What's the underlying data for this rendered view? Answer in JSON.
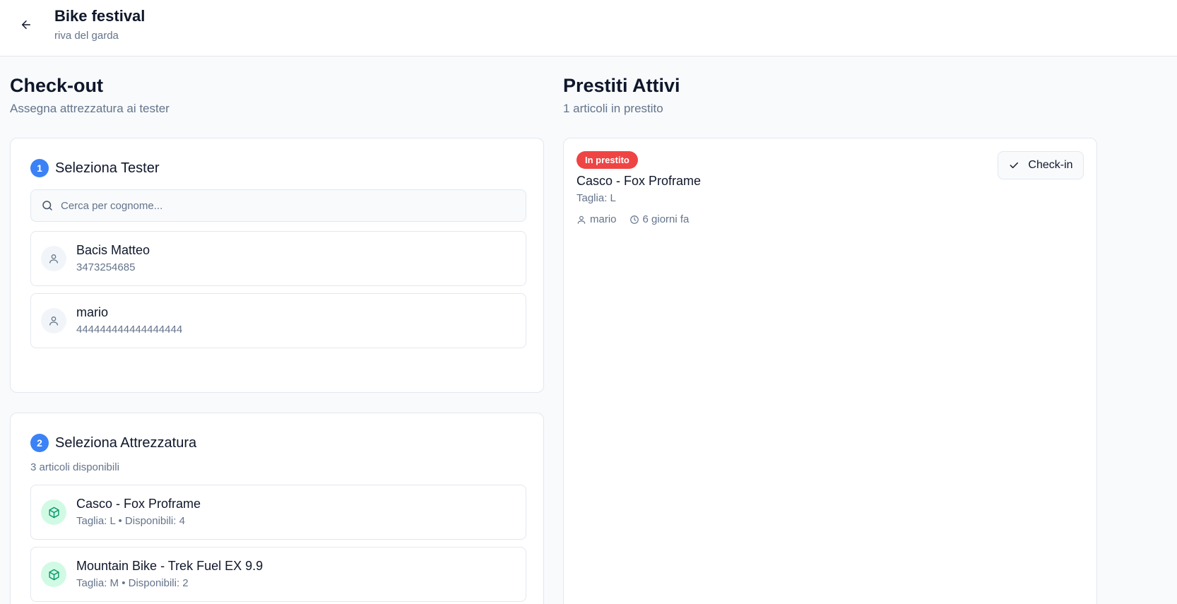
{
  "header": {
    "title": "Bike festival",
    "subtitle": "riva del garda"
  },
  "checkout": {
    "title": "Check-out",
    "subtitle": "Assegna attrezzatura ai tester",
    "step1": {
      "number": "1",
      "title": "Seleziona Tester",
      "search_placeholder": "Cerca per cognome...",
      "testers": [
        {
          "name": "Bacis Matteo",
          "phone": "3473254685"
        },
        {
          "name": "mario",
          "phone": "444444444444444444"
        }
      ]
    },
    "step2": {
      "number": "2",
      "title": "Seleziona Attrezzatura",
      "available_count": "3 articoli disponibili",
      "items": [
        {
          "name": "Casco - Fox Proframe",
          "details": "Taglia: L • Disponibili: 4"
        },
        {
          "name": "Mountain Bike - Trek Fuel EX 9.9",
          "details": "Taglia: M • Disponibili: 2"
        }
      ]
    }
  },
  "active_loans": {
    "title": "Prestiti Attivi",
    "subtitle": "1 articoli in prestito",
    "loans": [
      {
        "status": "In prestito",
        "item": "Casco - Fox Proframe",
        "size": "Taglia: L",
        "tester": "mario",
        "time": "6 giorni fa",
        "action_label": "Check-in"
      }
    ]
  },
  "colors": {
    "accent": "#3b82f6",
    "danger": "#ef4444",
    "success": "#10b981"
  }
}
